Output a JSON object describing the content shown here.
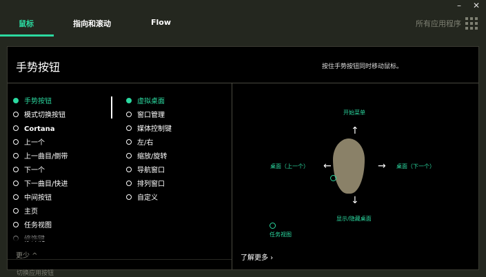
{
  "window": {
    "minimize": "–",
    "close": "✕"
  },
  "tabs": [
    {
      "label": "鼠标",
      "active": true
    },
    {
      "label": "指向和滚动",
      "active": false
    },
    {
      "label": "Flow",
      "active": false
    }
  ],
  "all_apps_label": "所有应用程序",
  "panel": {
    "title": "手势按钮",
    "hint": "按住手势按钮同时移动鼠标。"
  },
  "buttons_list": [
    {
      "label": "手势按钮",
      "selected": true
    },
    {
      "label": "模式切换按钮",
      "selected": false
    },
    {
      "label": "Cortana",
      "selected": false
    },
    {
      "label": "上一个",
      "selected": false
    },
    {
      "label": "上一曲目/倒带",
      "selected": false
    },
    {
      "label": "下一个",
      "selected": false
    },
    {
      "label": "下一曲目/快进",
      "selected": false
    },
    {
      "label": "中间按钮",
      "selected": false
    },
    {
      "label": "主页",
      "selected": false
    },
    {
      "label": "任务视图",
      "selected": false
    },
    {
      "label": "修饰键",
      "selected": false
    }
  ],
  "gesture_options": [
    {
      "label": "虚拟桌面",
      "selected": true
    },
    {
      "label": "窗口管理",
      "selected": false
    },
    {
      "label": "媒体控制键",
      "selected": false
    },
    {
      "label": "左/右",
      "selected": false
    },
    {
      "label": "缩放/旋转",
      "selected": false
    },
    {
      "label": "导航窗口",
      "selected": false
    },
    {
      "label": "排列窗口",
      "selected": false
    },
    {
      "label": "自定义",
      "selected": false
    }
  ],
  "more_label": "更少 ^",
  "bottom_cut_label": "切换应用按钮",
  "learn_more": "了解更多 ›",
  "gesture_labels": {
    "up": "开始菜单",
    "left": "桌面（上一个）",
    "right": "桌面（下一个）",
    "down": "显示/隐藏桌面",
    "tap": "任务视图"
  },
  "arrows": {
    "up": "↑",
    "down": "↓",
    "left": "←",
    "right": "→"
  },
  "colors": {
    "accent": "#2bd9a0",
    "background": "#24271f",
    "panel": "#000000",
    "mouse": "#8a8168"
  },
  "icons": [
    "apps-grid-icon",
    "radio-selected-icon",
    "radio-icon",
    "chevron-up-icon",
    "chevron-right-icon",
    "mouse-illustration"
  ]
}
